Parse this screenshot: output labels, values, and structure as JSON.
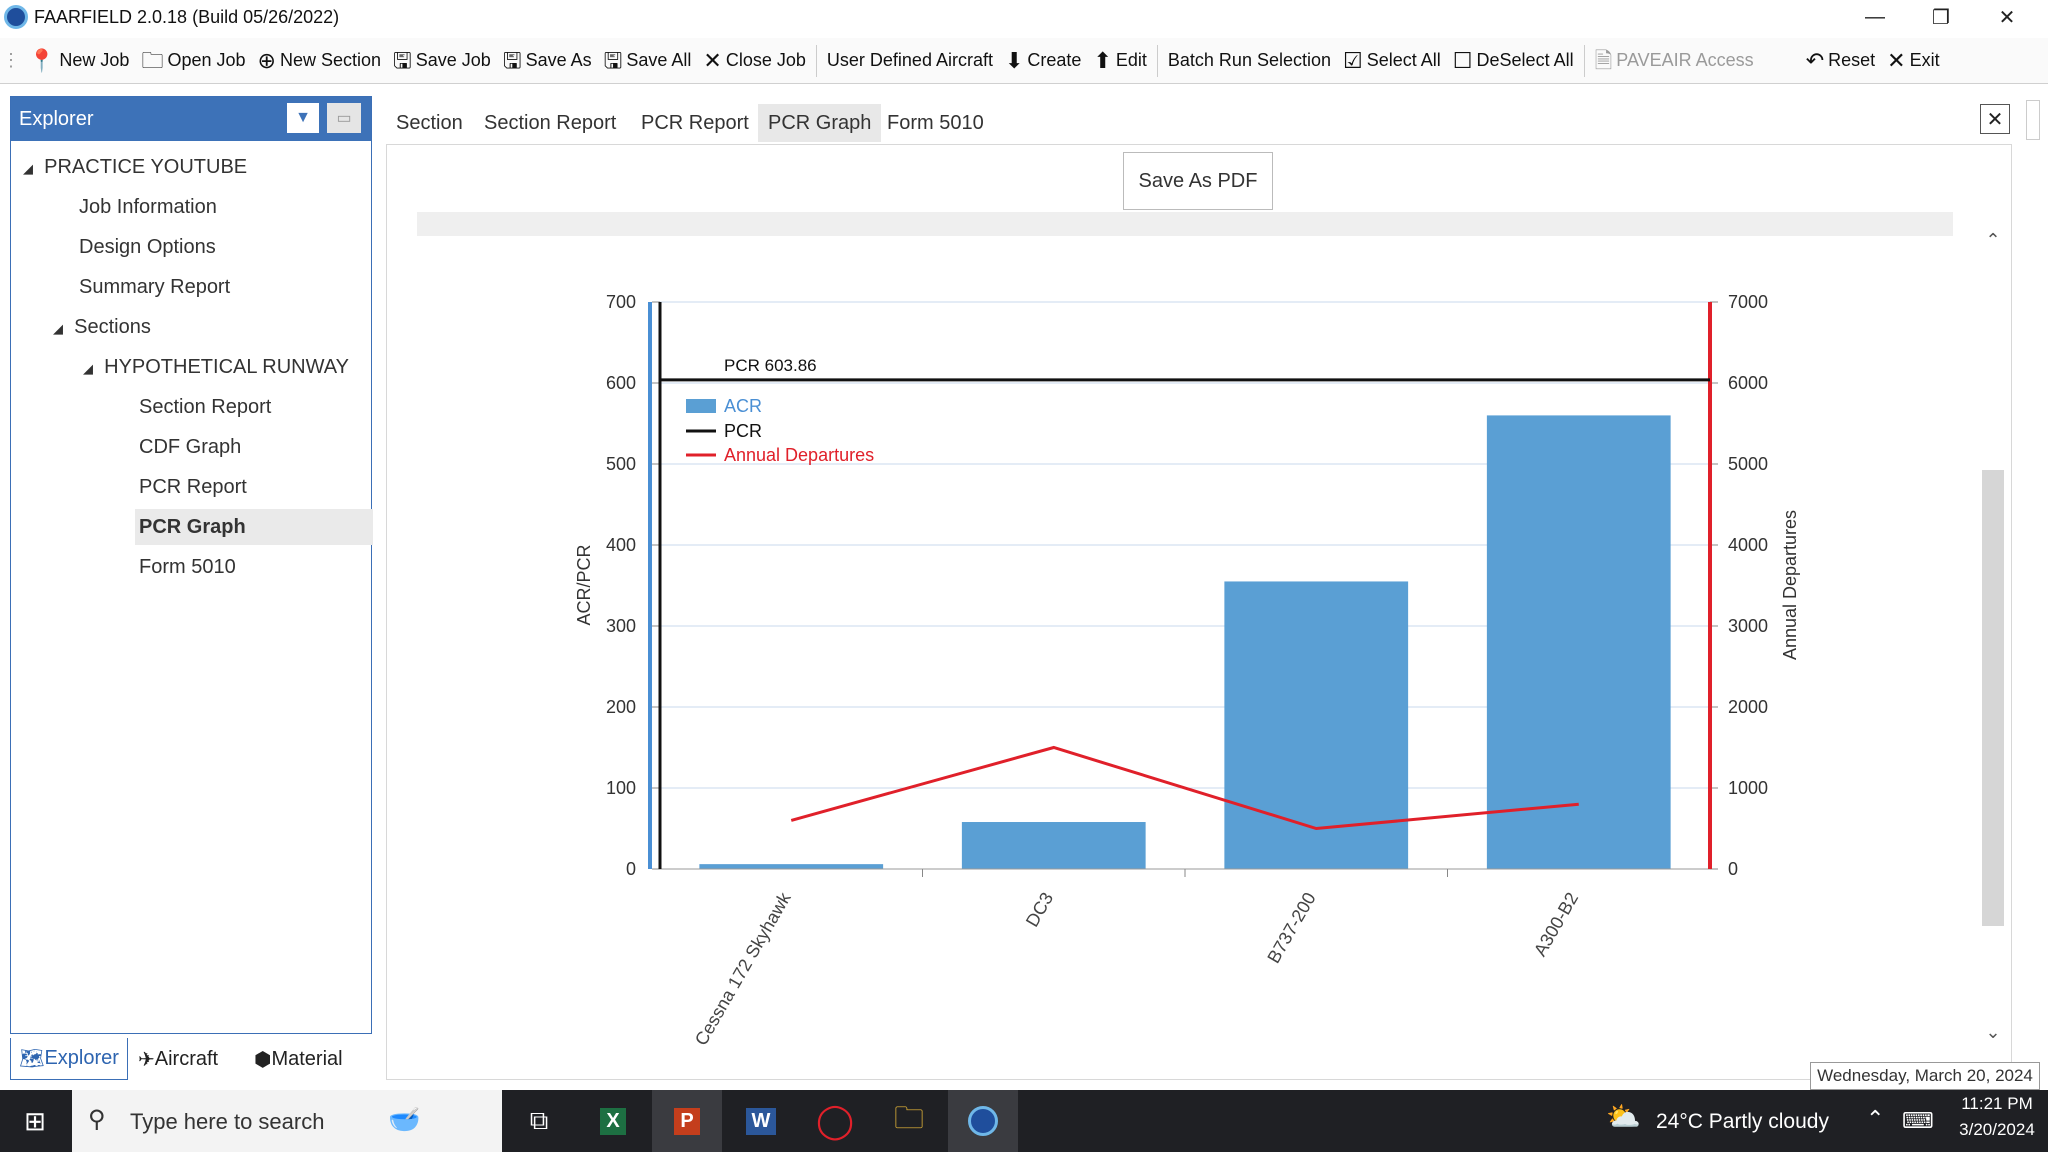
{
  "window": {
    "title": "FAARFIELD 2.0.18 (Build 05/26/2022)"
  },
  "toolbar": {
    "new_job": "New Job",
    "open_job": "Open Job",
    "new_section": "New Section",
    "save_job": "Save Job",
    "save_as": "Save As",
    "save_all": "Save All",
    "close_job": "Close Job",
    "user_defined_aircraft": "User Defined Aircraft",
    "create": "Create",
    "edit": "Edit",
    "batch_run_selection": "Batch Run Selection",
    "select_all": "Select All",
    "deselect_all": "DeSelect All",
    "paveair_access": "PAVEAIR Access",
    "reset": "Reset",
    "exit": "Exit"
  },
  "explorer": {
    "title": "Explorer",
    "tree": {
      "root": "PRACTICE YOUTUBE",
      "job_information": "Job Information",
      "design_options": "Design Options",
      "summary_report": "Summary Report",
      "sections": "Sections",
      "runway": "HYPOTHETICAL RUNWAY",
      "section_report": "Section Report",
      "cdf_graph": "CDF Graph",
      "pcr_report": "PCR Report",
      "pcr_graph": "PCR Graph",
      "form_5010": "Form 5010"
    },
    "bottom_tabs": {
      "explorer": "Explorer",
      "aircraft": "Aircraft",
      "material": "Material"
    }
  },
  "main_tabs": {
    "section": "Section",
    "section_report": "Section Report",
    "pcr_report": "PCR Report",
    "pcr_graph": "PCR Graph",
    "form_5010": "Form 5010"
  },
  "save_pdf": "Save As PDF",
  "chart_data": {
    "type": "bar",
    "categories": [
      "Cessna 172 Skyhawk",
      "DC3",
      "B737-200",
      "A300-B2"
    ],
    "series": [
      {
        "name": "ACR",
        "type": "bar",
        "axis": "left",
        "values": [
          6,
          58,
          355,
          560
        ],
        "color": "#5a9fd4"
      },
      {
        "name": "Annual Departures",
        "type": "line",
        "axis": "right",
        "values": [
          600,
          1500,
          500,
          800
        ],
        "color": "#e0202a"
      }
    ],
    "reference_line": {
      "name": "PCR",
      "value": 603.86,
      "label": "PCR 603.86",
      "color": "#111111"
    },
    "ylabel": "ACR/PCR",
    "y2label": "Annual Departures",
    "ylim": [
      0,
      700
    ],
    "y2lim": [
      0,
      7000
    ],
    "yticks": [
      "0",
      "100",
      "200",
      "300",
      "400",
      "500",
      "600",
      "700"
    ],
    "y2ticks": [
      "0",
      "1000",
      "2000",
      "3000",
      "4000",
      "5000",
      "6000",
      "7000"
    ],
    "legend": {
      "placement": "top-left",
      "entries": [
        "ACR",
        "PCR",
        "Annual Departures"
      ]
    },
    "grid": true
  },
  "status": {
    "date_tooltip": "Wednesday, March 20, 2024"
  },
  "taskbar": {
    "search_placeholder": "Type here to search",
    "weather": "24°C  Partly cloudy",
    "time": "11:21 PM",
    "date": "3/20/2024"
  }
}
